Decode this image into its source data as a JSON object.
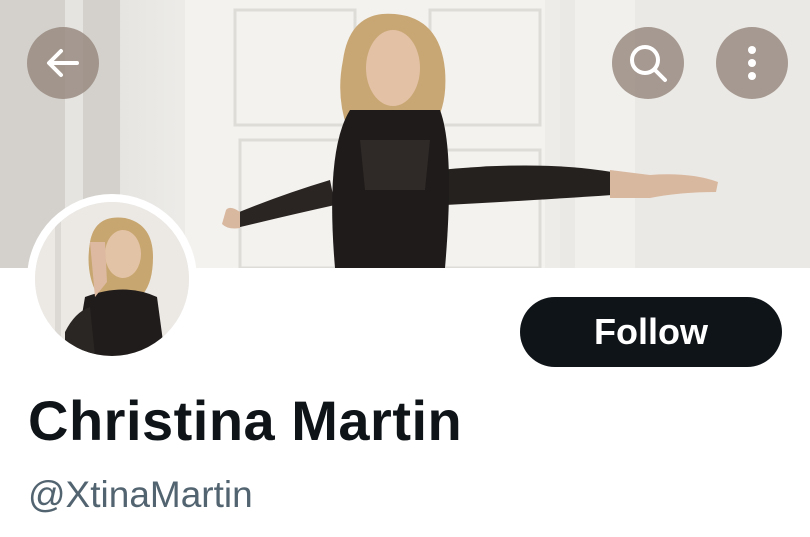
{
  "header": {
    "back_icon": "arrow-left-icon",
    "search_icon": "search-icon",
    "more_icon": "more-vertical-icon"
  },
  "profile": {
    "display_name": "Christina Martin",
    "handle": "@XtinaMartin",
    "follow_label": "Follow"
  },
  "colors": {
    "follow_bg": "#0f1419",
    "follow_text": "#ffffff",
    "name_text": "#0f1419",
    "handle_text": "#536471",
    "header_button_bg": "#96887e"
  }
}
